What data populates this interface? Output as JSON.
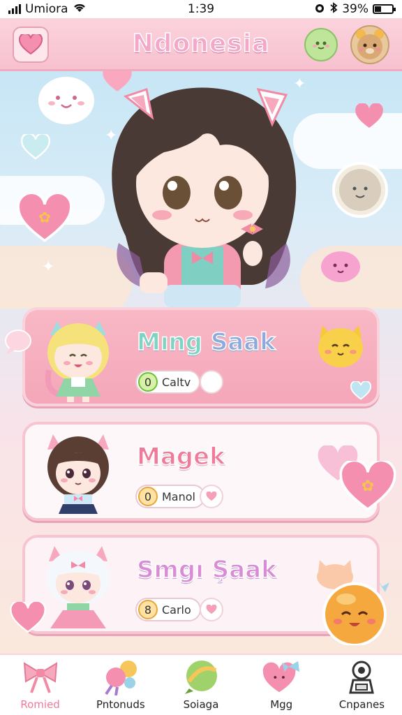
{
  "status_bar": {
    "carrier": "Umiora",
    "time": "1:39",
    "battery_percent": "39%",
    "battery_level": 0.39
  },
  "header": {
    "title": "Ndonesia"
  },
  "cards": [
    {
      "name_part1": "Mıng",
      "name_part2": "Saak",
      "badge": "0",
      "pill_text": "Caltv"
    },
    {
      "name_part1": "Magek",
      "name_part2": "",
      "badge": "0",
      "pill_text": "Manol"
    },
    {
      "name_part1": "Smgı",
      "name_part2": "Şaak",
      "badge": "8",
      "pill_text": "Carlo"
    }
  ],
  "nav": [
    {
      "label": "Romied",
      "icon": "bow-icon",
      "active": true
    },
    {
      "label": "Pntonuds",
      "icon": "candy-icon",
      "active": false
    },
    {
      "label": "Soiaga",
      "icon": "leaf-ball-icon",
      "active": false
    },
    {
      "label": "Mgg",
      "icon": "heart-bow-icon",
      "active": false
    },
    {
      "label": "Cnpanes",
      "icon": "robot-icon",
      "active": false
    }
  ],
  "colors": {
    "accent_pink": "#f4a7c8",
    "card1": "#f4a7b9",
    "nav_active": "#f07a9a"
  }
}
